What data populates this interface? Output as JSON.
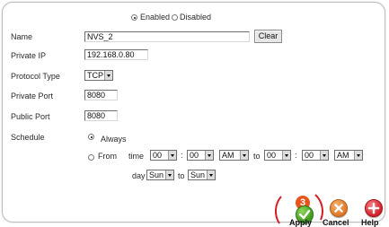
{
  "status": {
    "enabled_label": "Enabled",
    "disabled_label": "Disabled",
    "selected": "enabled"
  },
  "form": {
    "name": {
      "label": "Name",
      "value": "NVS_2",
      "clear_label": "Clear"
    },
    "private_ip": {
      "label": "Private IP",
      "value": "192.168.0.80"
    },
    "protocol_type": {
      "label": "Protocol Type",
      "value": "TCP"
    },
    "private_port": {
      "label": "Private Port",
      "value": "8080"
    },
    "public_port": {
      "label": "Public Port",
      "value": "8080"
    }
  },
  "schedule": {
    "label": "Schedule",
    "always_label": "Always",
    "from_label": "From",
    "time_label": "time",
    "to_label": "to",
    "day_label": "day",
    "selected": "always",
    "start_hour": "00",
    "start_minute": "00",
    "start_ampm": "AM",
    "end_hour": "00",
    "end_minute": "00",
    "end_ampm": "AM",
    "start_day": "Sun",
    "end_day": "Sun",
    "time_separator": ":"
  },
  "actions": {
    "step_badge": "3",
    "apply_label": "Apply",
    "cancel_label": "Cancel",
    "help_label": "Help",
    "colors": {
      "badge": "#e8541a",
      "apply": "#3f9a1e",
      "cancel": "#e0772a",
      "help": "#d5202a"
    }
  },
  "icons": {
    "apply": "check-icon",
    "cancel": "x-icon",
    "help": "plus-icon"
  }
}
